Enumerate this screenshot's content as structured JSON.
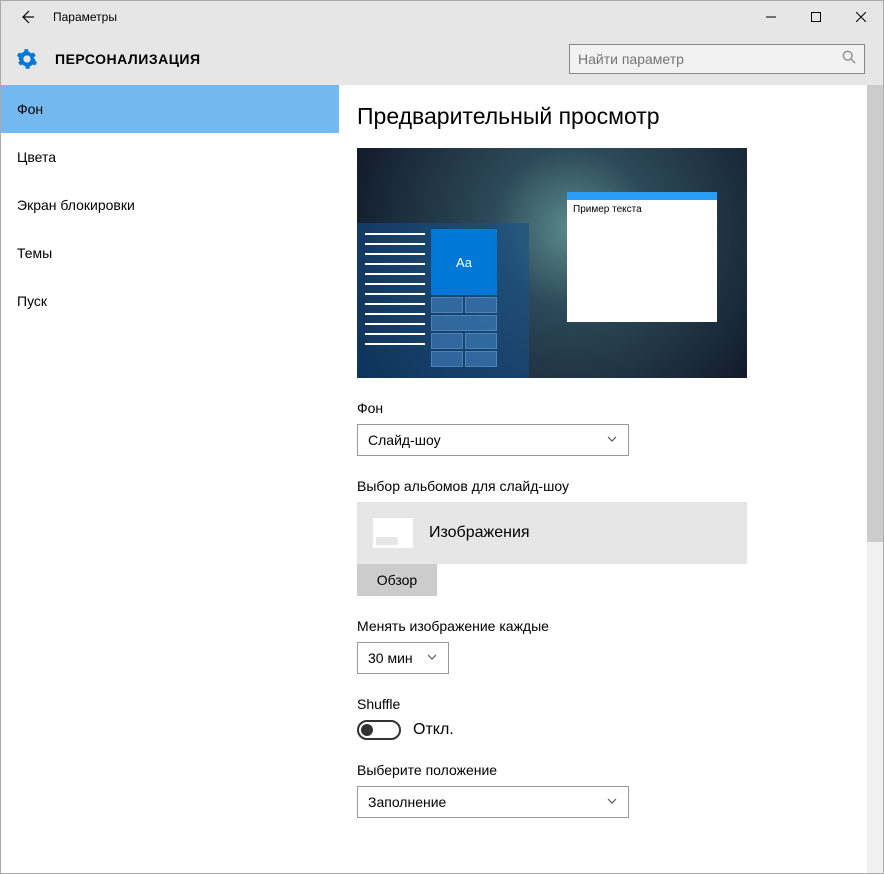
{
  "titlebar": {
    "title": "Параметры"
  },
  "header": {
    "section": "ПЕРСОНАЛИЗАЦИЯ",
    "search_placeholder": "Найти параметр"
  },
  "sidebar": {
    "items": [
      {
        "label": "Фон",
        "active": true
      },
      {
        "label": "Цвета",
        "active": false
      },
      {
        "label": "Экран блокировки",
        "active": false
      },
      {
        "label": "Темы",
        "active": false
      },
      {
        "label": "Пуск",
        "active": false
      }
    ]
  },
  "main": {
    "preview_title": "Предварительный просмотр",
    "preview_sample_text": "Пример текста",
    "preview_tile_text": "Aa",
    "background_label": "Фон",
    "background_value": "Слайд-шоу",
    "albums_label": "Выбор альбомов для слайд-шоу",
    "folder_name": "Изображения",
    "browse_label": "Обзор",
    "interval_label": "Менять изображение каждые",
    "interval_value": "30 мин",
    "shuffle_label": "Shuffle",
    "shuffle_state": "Откл.",
    "position_label": "Выберите положение",
    "position_value": "Заполнение"
  }
}
